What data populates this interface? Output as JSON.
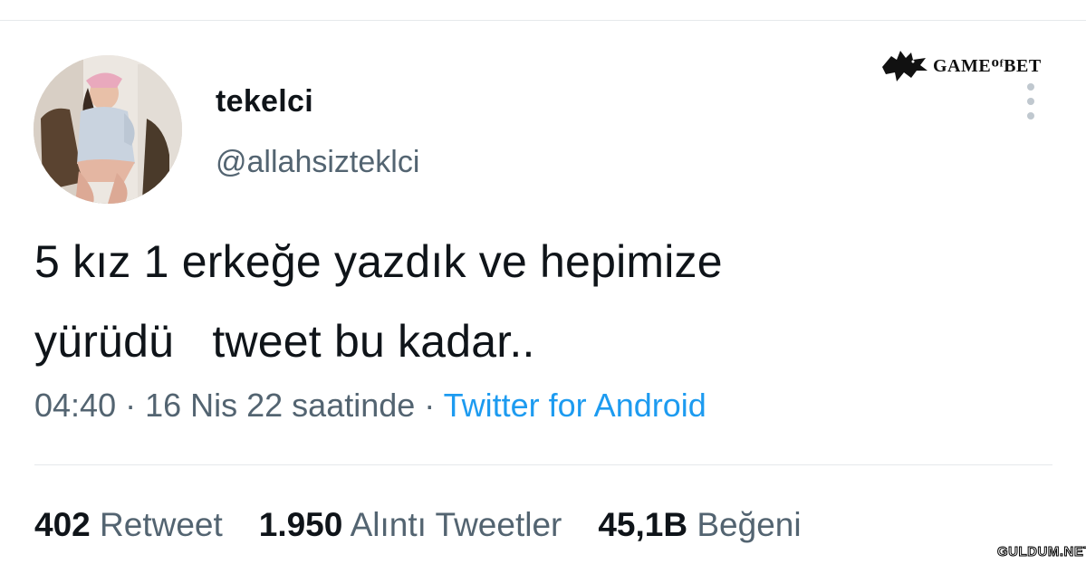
{
  "user": {
    "display_name": "tekelci",
    "handle": "@allahsizteklci"
  },
  "tweet": {
    "text_line1": "5 kız 1 erkeğe yazdık ve hepimize",
    "text_line2": "yürüdü   tweet bu kadar..",
    "time": "04:40",
    "date": "16 Nis 22 saatinde",
    "separator": " · ",
    "source": "Twitter for Android"
  },
  "stats": {
    "retweets": {
      "num": "402",
      "label": "Retweet"
    },
    "quotes": {
      "num": "1.950",
      "label": "Alıntı Tweetler"
    },
    "likes": {
      "num": "45,1B",
      "label": "Beğeni"
    }
  },
  "watermarks": {
    "top": "GAMEᴼᶠBET",
    "bottom": "GULDUM.NET"
  },
  "icons": {
    "more": "more-vertical-icon",
    "wolf": "wolf-logo-icon"
  },
  "colors": {
    "text": "#0f1419",
    "secondary": "#536471",
    "link": "#1d9bf0",
    "divider": "#e6e9eb"
  }
}
